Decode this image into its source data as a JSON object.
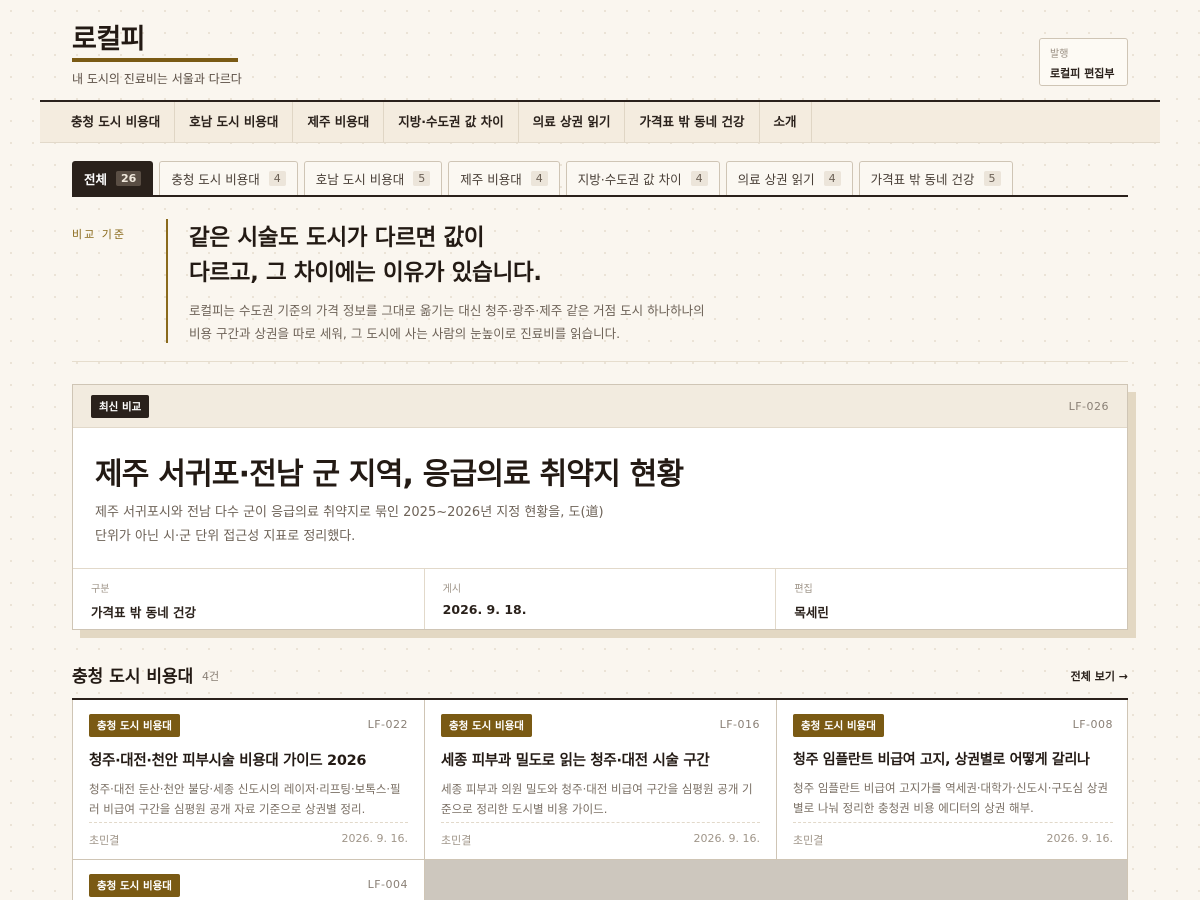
{
  "site": {
    "title": "로컬피",
    "tagline": "내 도시의 진료비는 서울과 다르다",
    "publisher_label": "발행",
    "publisher_value": "로컬피 편집부"
  },
  "nav": {
    "items": [
      "충청 도시 비용대",
      "호남 도시 비용대",
      "제주 비용대",
      "지방·수도권 값 차이",
      "의료 상권 읽기",
      "가격표 밖 동네 건강",
      "소개"
    ]
  },
  "tabs": [
    {
      "label": "전체",
      "count": "26",
      "active": true
    },
    {
      "label": "충청 도시 비용대",
      "count": "4",
      "active": false
    },
    {
      "label": "호남 도시 비용대",
      "count": "5",
      "active": false
    },
    {
      "label": "제주 비용대",
      "count": "4",
      "active": false
    },
    {
      "label": "지방·수도권 값 차이",
      "count": "4",
      "active": false
    },
    {
      "label": "의료 상권 읽기",
      "count": "4",
      "active": false
    },
    {
      "label": "가격표 밖 동네 건강",
      "count": "5",
      "active": false
    }
  ],
  "intro": {
    "kicker": "비교 기준",
    "headline_line1": "같은 시술도 도시가 다르면 값이",
    "headline_line2": "다르고, 그 차이에는 이유가 있습니다.",
    "body_line1": "로컬피는 수도권 기준의 가격 정보를 그대로 옮기는 대신 청주·광주·제주 같은 거점 도시 하나하나의",
    "body_line2": "비용 구간과 상권을 따로 세워, 그 도시에 사는 사람의 눈높이로 진료비를 읽습니다."
  },
  "featured": {
    "badge": "최신 비교",
    "code": "LF-026",
    "title": "제주 서귀포·전남 군 지역, 응급의료 취약지 현황",
    "desc_line1": "제주 서귀포시와 전남 다수 군이 응급의료 취약지로 묶인 2025~2026년 지정 현황을, 도(道)",
    "desc_line2": "단위가 아닌 시·군 단위 접근성 지표로 정리했다.",
    "meta": [
      {
        "label": "구분",
        "value": "가격표 밖 동네 건강"
      },
      {
        "label": "게시",
        "value": "2026. 9. 18."
      },
      {
        "label": "편집",
        "value": "목세린"
      }
    ]
  },
  "section": {
    "title": "충청 도시 비용대",
    "count": "4건",
    "all_link": "전체 보기 →",
    "cards": [
      {
        "category": "충청 도시 비용대",
        "code": "LF-022",
        "title": "청주·대전·천안 피부시술 비용대 가이드 2026",
        "desc": "청주·대전 둔산·천안 불당·세종 신도시의 레이저·리프팅·보톡스·필러 비급여 구간을 심평원 공개 자료 기준으로 상권별 정리.",
        "author": "초민결",
        "date": "2026. 9. 16."
      },
      {
        "category": "충청 도시 비용대",
        "code": "LF-016",
        "title": "세종 피부과 밀도로 읽는 청주·대전 시술 구간",
        "desc": "세종 피부과 의원 밀도와 청주·대전 비급여 구간을 심평원 공개 기준으로 정리한 도시별 비용 가이드.",
        "author": "초민결",
        "date": "2026. 9. 16."
      },
      {
        "category": "충청 도시 비용대",
        "code": "LF-008",
        "title": "청주 임플란트 비급여 고지, 상권별로 어떻게 갈리나",
        "desc": "청주 임플란트 비급여 고지가를 역세권·대학가·신도시·구도심 상권별로 나눠 정리한 충청권 비용 에디터의 상권 해부.",
        "author": "초민결",
        "date": "2026. 9. 16."
      },
      {
        "category": "충청 도시 비용대",
        "code": "LF-004",
        "title": "",
        "desc": "",
        "author": "",
        "date": ""
      }
    ]
  }
}
